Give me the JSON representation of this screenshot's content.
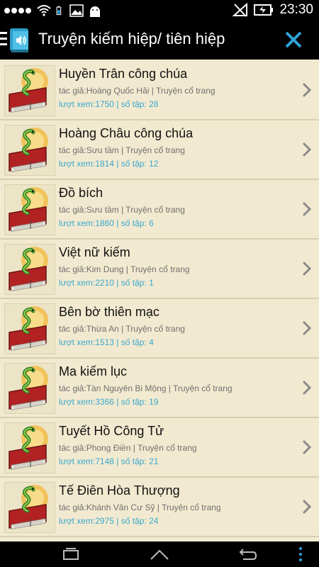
{
  "status": {
    "time": "23:30",
    "icons": [
      "signal-dots",
      "wifi-icon",
      "battery-icon",
      "image-icon",
      "android-icon",
      "no-signal-icon",
      "battery-charging-icon"
    ]
  },
  "header": {
    "title": "Truyện kiếm hiệp/ tiên hiệp",
    "accent": "#2fa3d8"
  },
  "stories": [
    {
      "title": "Huyền Trân công chúa",
      "meta": "tác giả:Hoàng Quốc Hải | Truyện cổ trang",
      "stats": "lượt xem:1750 | số tập: 28"
    },
    {
      "title": "Hoàng Châu công chúa",
      "meta": "tác giả:Sưu tầm | Truyện cổ trang",
      "stats": "lượt xem:1814 | số tập: 12"
    },
    {
      "title": "Đồ bích",
      "meta": "tác giả:Sưu tầm | Truyện cổ trang",
      "stats": "lượt xem:1860 | số tập: 6"
    },
    {
      "title": "Việt nữ kiếm",
      "meta": "tác giả:Kim Dung | Truyện cổ trang",
      "stats": "lượt xem:2210 | số tập: 1"
    },
    {
      "title": "Bên bờ thiên mạc",
      "meta": "tác giả:Thừa An | Truyện cổ trang",
      "stats": "lượt xem:1513 | số tập: 4"
    },
    {
      "title": "Ma kiếm lục",
      "meta": "tác giả:Tàn Nguyên Bi Mộng | Truyện cổ trang",
      "stats": "lượt xem:3366 | số tập: 19"
    },
    {
      "title": "Tuyết Hồ Công Tử",
      "meta": "tác giả:Phong Điền | Truyện cổ trang",
      "stats": "lượt xem:7148 | số tập: 21"
    },
    {
      "title": "Tế Điên Hòa Thượng",
      "meta": "tác giả:Khánh Vân Cư Sỹ | Truyện cổ trang",
      "stats": "lượt xem:2975 | số tập: 24"
    }
  ],
  "colors": {
    "background": "#f2ead0",
    "stats_text": "#3aa7cf",
    "bar": "#000000"
  }
}
